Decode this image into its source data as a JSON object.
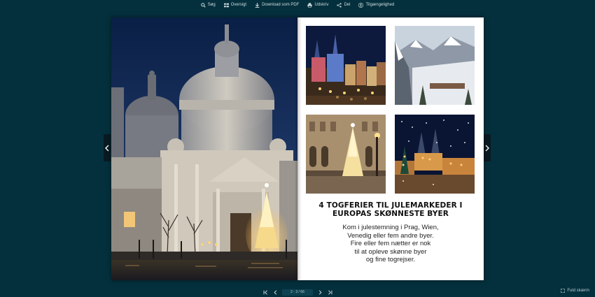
{
  "toolbar": {
    "search": "Søg",
    "overview": "Oversigt",
    "download": "Download som PDF",
    "print": "Udskriv",
    "share": "Del",
    "accessibility": "Tilgængelighed"
  },
  "right_page": {
    "headline_line1": "4 TOGFERIER TIL JULEMARKEDER I",
    "headline_line2": "EUROPAS SKØNNESTE BYER",
    "body_lines": [
      "Kom i julestemning i Prag, Wien,",
      "Venedig eller fem andre byer.",
      "Fire eller fem nætter er nok",
      "til at opleve skønne  byer",
      "og fine togrejser."
    ]
  },
  "pager": {
    "page_indicator": "2 - 3 / 66"
  },
  "fullscreen_label": "Fuld skærm",
  "icons": {
    "search": "search-icon",
    "overview": "grid-icon",
    "download": "download-icon",
    "print": "printer-icon",
    "share": "share-icon",
    "accessibility": "accessibility-icon"
  },
  "colors": {
    "background": "#04303d",
    "page": "#ffffff"
  }
}
